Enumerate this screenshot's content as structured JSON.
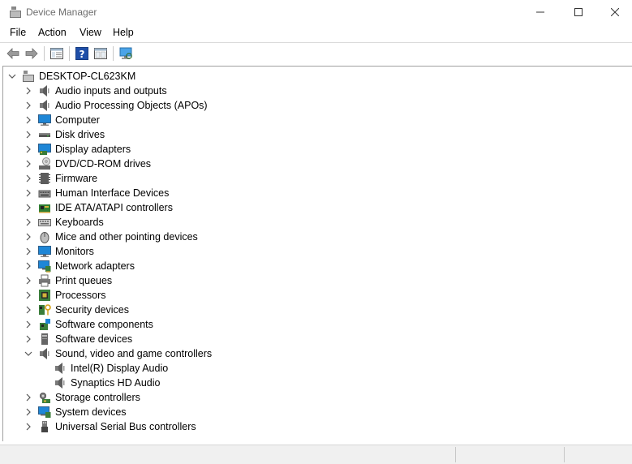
{
  "window": {
    "title": "Device Manager"
  },
  "menu": [
    "File",
    "Action",
    "View",
    "Help"
  ],
  "toolbar": {
    "buttons": [
      "back-icon",
      "forward-icon",
      "show-hide-console-tree-icon",
      "help-icon",
      "properties-icon",
      "scan-hardware-icon"
    ]
  },
  "tree": {
    "root": "DESKTOP-CL623KM",
    "categories": [
      {
        "label": "Audio inputs and outputs",
        "icon": "speaker-icon",
        "expanded": false
      },
      {
        "label": "Audio Processing Objects (APOs)",
        "icon": "speaker-icon",
        "expanded": false
      },
      {
        "label": "Computer",
        "icon": "monitor-icon",
        "expanded": false
      },
      {
        "label": "Disk drives",
        "icon": "disk-drive-icon",
        "expanded": false
      },
      {
        "label": "Display adapters",
        "icon": "display-adapter-icon",
        "expanded": false
      },
      {
        "label": "DVD/CD-ROM drives",
        "icon": "dvd-drive-icon",
        "expanded": false
      },
      {
        "label": "Firmware",
        "icon": "firmware-icon",
        "expanded": false
      },
      {
        "label": "Human Interface Devices",
        "icon": "hid-icon",
        "expanded": false
      },
      {
        "label": "IDE ATA/ATAPI controllers",
        "icon": "ide-controller-icon",
        "expanded": false
      },
      {
        "label": "Keyboards",
        "icon": "keyboard-icon",
        "expanded": false
      },
      {
        "label": "Mice and other pointing devices",
        "icon": "mouse-icon",
        "expanded": false
      },
      {
        "label": "Monitors",
        "icon": "monitor-icon",
        "expanded": false
      },
      {
        "label": "Network adapters",
        "icon": "network-adapter-icon",
        "expanded": false
      },
      {
        "label": "Print queues",
        "icon": "printer-icon",
        "expanded": false
      },
      {
        "label": "Processors",
        "icon": "processor-icon",
        "expanded": false
      },
      {
        "label": "Security devices",
        "icon": "security-device-icon",
        "expanded": false
      },
      {
        "label": "Software components",
        "icon": "software-component-icon",
        "expanded": false
      },
      {
        "label": "Software devices",
        "icon": "software-device-icon",
        "expanded": false
      },
      {
        "label": "Sound, video and game controllers",
        "icon": "speaker-icon",
        "expanded": true,
        "children": [
          "Intel(R) Display Audio",
          "Synaptics HD Audio"
        ]
      },
      {
        "label": "Storage controllers",
        "icon": "storage-controller-icon",
        "expanded": false
      },
      {
        "label": "System devices",
        "icon": "system-device-icon",
        "expanded": false
      },
      {
        "label": "Universal Serial Bus controllers",
        "icon": "usb-icon",
        "expanded": false
      }
    ]
  },
  "colors": {
    "titleText": "#6d6d6d",
    "iconBlue": "#1e86d6",
    "iconGray": "#5a5a5a",
    "statusBar": "#f0f0f0"
  }
}
